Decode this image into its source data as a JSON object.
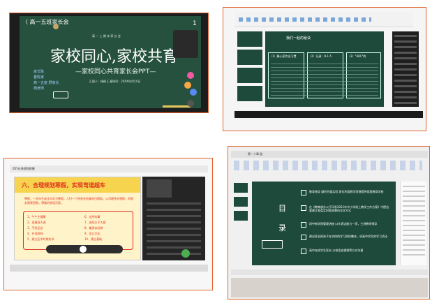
{
  "panel1": {
    "back_label": "〈 高一五班家长会",
    "subtitle_small": "高 一 上 期 末 家 长 会",
    "main_title": "家校同心,家校共育",
    "sub_title": "—家校同心共育家长会PPT—",
    "reporter": "汇报人：杨柄  汇报时间：20XX年X月X日",
    "left_names": [
      "家长陈",
      "晋陈家",
      "高一五班 野家长",
      "杨老师"
    ],
    "like_count": "1"
  },
  "panel2": {
    "slide_title": "我们一起的秘诀",
    "boxes": [
      {
        "title": "（1）静心家作业习惯"
      },
      {
        "title": "（2）记录：8-1-5"
      },
      {
        "title": "（3）\"ABC\"的"
      }
    ]
  },
  "panel3": {
    "app_title": "ZKY在线视频直播",
    "slide_title": "六、合理规划寒假，实现弯道超车",
    "paragraph": "寒假，一学年生成法大好为寒假，人们一个热急先检查的日期现，公司理性的想顾，的朋友图表思图，想看的发现活家。",
    "left_list": [
      "1、午午主健康",
      "2、身康身大调",
      "3、手机品自",
      "4、开设网线",
      "5、建立区中时效的书"
    ],
    "right_list": [
      "6、出所的事",
      "7、安阳主子大意",
      "8、集资实际教",
      "9、设立文化",
      "10、建立基础"
    ]
  },
  "panel4": {
    "app_tab": "第一十章 副",
    "slide_left": [
      "目",
      "录"
    ],
    "items": [
      {
        "text": "教育指导 顺利开展实验 家长利用教学资源提供家庭教育学校",
        "red": "顺利开展实验"
      },
      {
        "text": "在《教育部办公厅印发2021年中小学线上教学工作方案》中提出要建立各类实时收效果的导学方式",
        "red": "建立各类实时收效果"
      },
      {
        "text": "初中新学院管理讲座 口头表达能力一项，主讲教师指导",
        "red": "口头表达能力一项"
      },
      {
        "text": "建议家长把孩子在学校的学习资料整合，初高中学生的学习活动",
        "red": ""
      },
      {
        "text": "高中在校学生家长 以电话或视频等方式沟通",
        "red": "以电话或视频"
      }
    ]
  }
}
